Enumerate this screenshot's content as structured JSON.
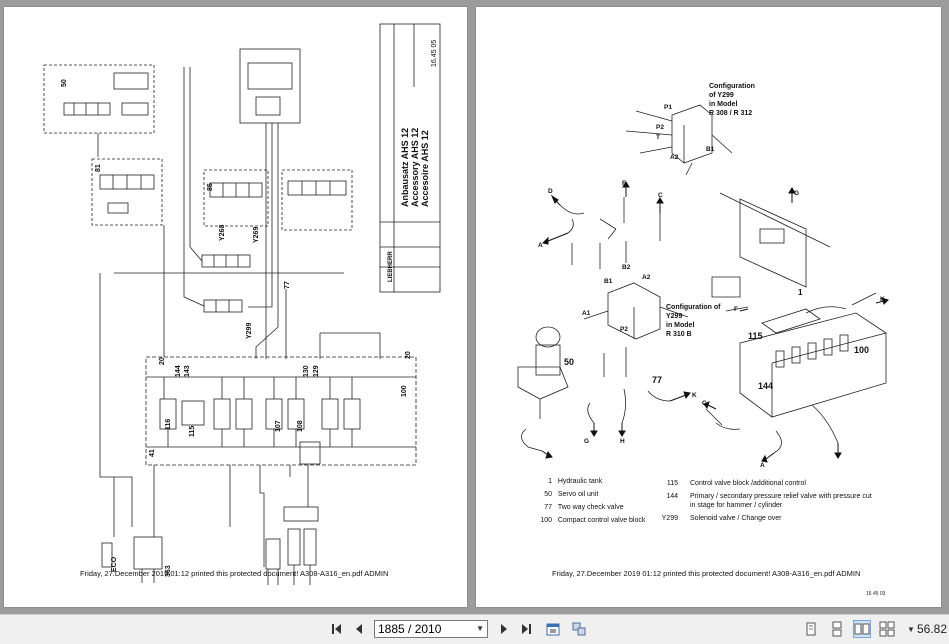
{
  "left_page": {
    "footer": "Friday, 27.December 2019 01:12 printed this protected document! A308-A316_en.pdf ADMIN",
    "title_lines": [
      "Anbausatz AHS 12",
      "Accessory AHS 12",
      "Accesoire AHS 12"
    ],
    "doc_number": "16.45 05",
    "brand": "LIEBHERR",
    "labels": {
      "y268": "Y268",
      "y269": "Y269",
      "y299": "Y299",
      "n77": "77",
      "n20a": "20",
      "n20b": "20",
      "n100": "100",
      "n130": "130",
      "n129": "129",
      "n144": "144",
      "n143": "143",
      "n116": "116",
      "n115": "115",
      "n41": "41",
      "n107": "107",
      "n108": "108",
      "n50": "50",
      "n81": "81",
      "n85": "85",
      "eco": "ECO",
      "n363": "363"
    }
  },
  "right_page": {
    "footer": "Friday, 27.December 2019 01:12 printed this protected document! A308-A316_en.pdf ADMIN",
    "code": "16 45 03",
    "config_top": [
      "Configuration",
      "of Y299",
      "in Model",
      "R 308 / R 312"
    ],
    "config_mid": [
      "Configuration of",
      "Y299",
      "in Model",
      "R 310 B"
    ],
    "callouts": {
      "d1": "D",
      "f1": "F",
      "c1": "C",
      "g1": "G",
      "a1": "A",
      "b2": "B2",
      "b1a": "B1",
      "a2": "A2",
      "a1b": "A1",
      "pz": "P2",
      "n50": "50",
      "n77": "77",
      "k1": "K",
      "h1": "H",
      "g2": "G",
      "f2": "F",
      "n115": "115",
      "n100": "100",
      "k2": "K",
      "n144": "144",
      "c2": "C",
      "a3": "A",
      "n1": "1",
      "p1": "P1",
      "p2": "P2",
      "t1": "T",
      "a2b": "A2",
      "b1b": "B1"
    },
    "legend": [
      {
        "num": "1",
        "text": "Hydraulic tank"
      },
      {
        "num": "50",
        "text": "Servo oil unit"
      },
      {
        "num": "77",
        "text": "Two way check valve"
      },
      {
        "num": "100",
        "text": "Compact   control valve block"
      },
      {
        "num": "115",
        "text": "Control valve block /additional control"
      },
      {
        "num": "144",
        "text": "Primary / secondary pressure relief valve with pressure cut in stage  for hammer / cylinder"
      },
      {
        "num": "Y299",
        "text": "Solenoid valve / Change over"
      }
    ]
  },
  "toolbar": {
    "page_indicator": "1885 / 2010",
    "zoom": "56.82"
  }
}
